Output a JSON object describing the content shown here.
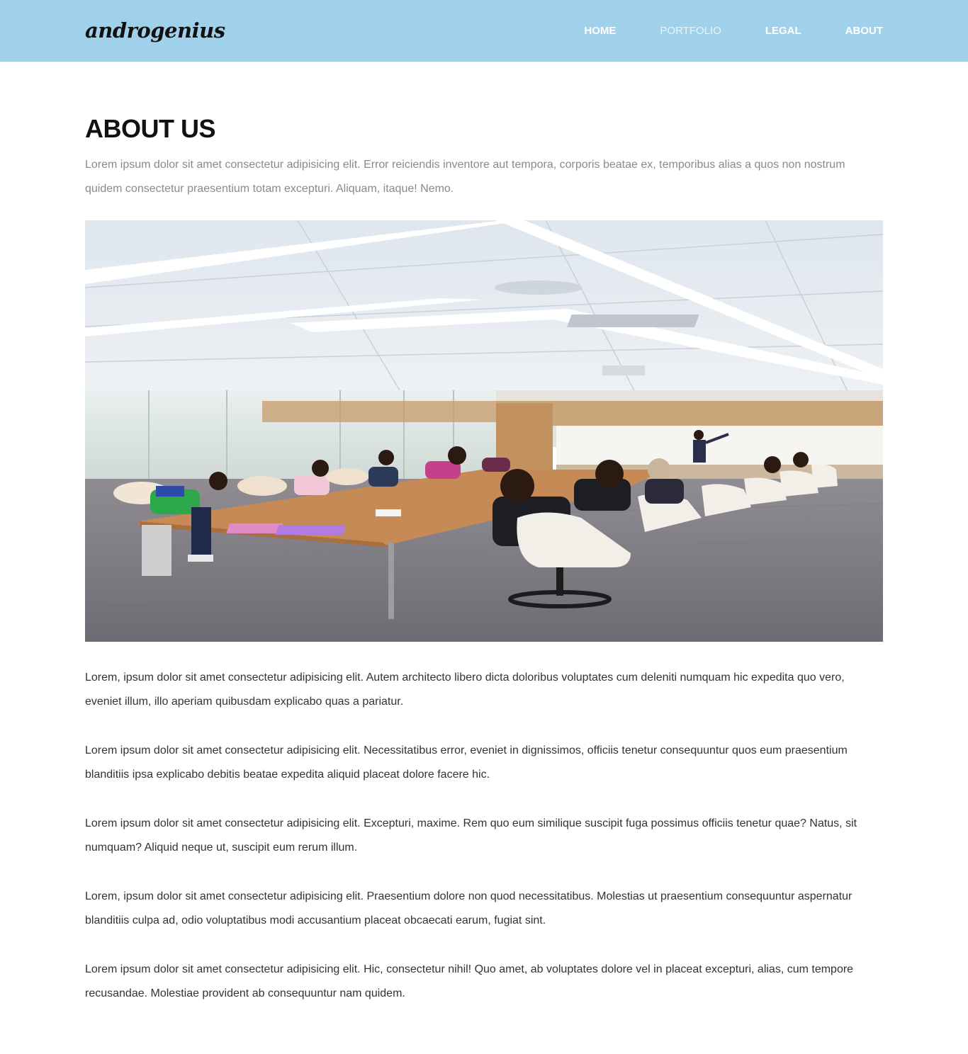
{
  "brand": {
    "logo_text": "androgenius"
  },
  "nav": {
    "items": [
      {
        "label": "HOME"
      },
      {
        "label": "PORTFOLIO"
      },
      {
        "label": "LEGAL"
      },
      {
        "label": "ABOUT"
      }
    ]
  },
  "main": {
    "title": "ABOUT US",
    "intro": "Lorem ipsum dolor sit amet consectetur adipisicing elit. Error reiciendis inventore aut tempora, corporis beatae ex, temporibus alias a quos non nostrum quidem consectetur praesentium totam excepturi. Aliquam, itaque! Nemo.",
    "paragraphs": [
      "Lorem, ipsum dolor sit amet consectetur adipisicing elit. Autem architecto libero dicta doloribus voluptates cum deleniti numquam hic expedita quo vero, eveniet illum, illo aperiam quibusdam explicabo quas a pariatur.",
      "Lorem ipsum dolor sit amet consectetur adipisicing elit. Necessitatibus error, eveniet in dignissimos, officiis tenetur consequuntur quos eum praesentium blanditiis ipsa explicabo debitis beatae expedita aliquid placeat dolore facere hic.",
      "Lorem ipsum dolor sit amet consectetur adipisicing elit. Excepturi, maxime. Rem quo eum similique suscipit fuga possimus officiis tenetur quae? Natus, sit numquam? Aliquid neque ut, suscipit eum rerum illum.",
      "Lorem, ipsum dolor sit amet consectetur adipisicing elit. Praesentium dolore non quod necessitatibus. Molestias ut praesentium consequuntur aspernatur blanditiis culpa ad, odio voluptatibus modi accusantium placeat obcaecati earum, fugiat sint.",
      "Lorem ipsum dolor sit amet consectetur adipisicing elit. Hic, consectetur nihil! Quo amet, ab voluptates dolore vel in placeat excepturi, alias, cum tempore recusandae. Molestiae provident ab consequuntur nam quidem."
    ]
  },
  "colors": {
    "navbar_bg": "#a0d1ea",
    "title": "#111111",
    "intro_text": "#8a8a8a",
    "body_text": "#333333"
  }
}
